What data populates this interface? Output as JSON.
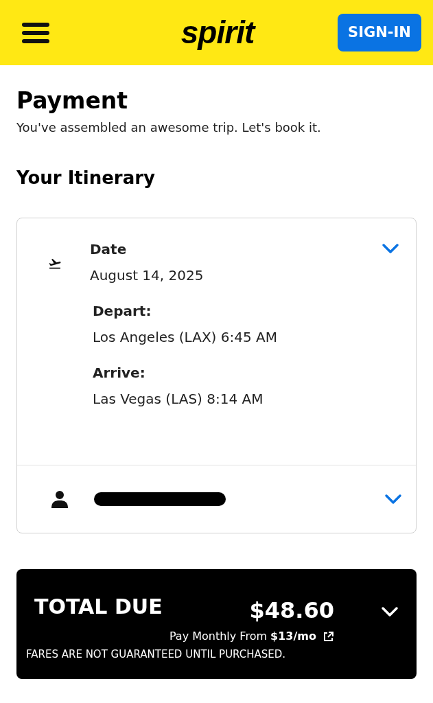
{
  "header": {
    "logo": "spirit",
    "sign_in": "SIGN-IN"
  },
  "page": {
    "title": "Payment",
    "subtitle": "You've assembled an awesome trip. Let's book it."
  },
  "itinerary": {
    "heading": "Your Itinerary",
    "flight": {
      "date_label": "Date",
      "date": "August 14, 2025",
      "legs": [
        {
          "label": "Depart:",
          "value": "Los Angeles (LAX) 6:45 AM"
        },
        {
          "label": "Arrive:",
          "value": "Las Vegas (LAS) 8:14 AM"
        }
      ]
    },
    "passenger": {
      "kind": "redacted"
    }
  },
  "total": {
    "label": "TOTAL DUE",
    "amount": "$48.60",
    "monthly": "Pay Monthly From **$13/mo**",
    "notice": "FARES ARE NOT GUARANTEED UNTIL PURCHASED."
  }
}
